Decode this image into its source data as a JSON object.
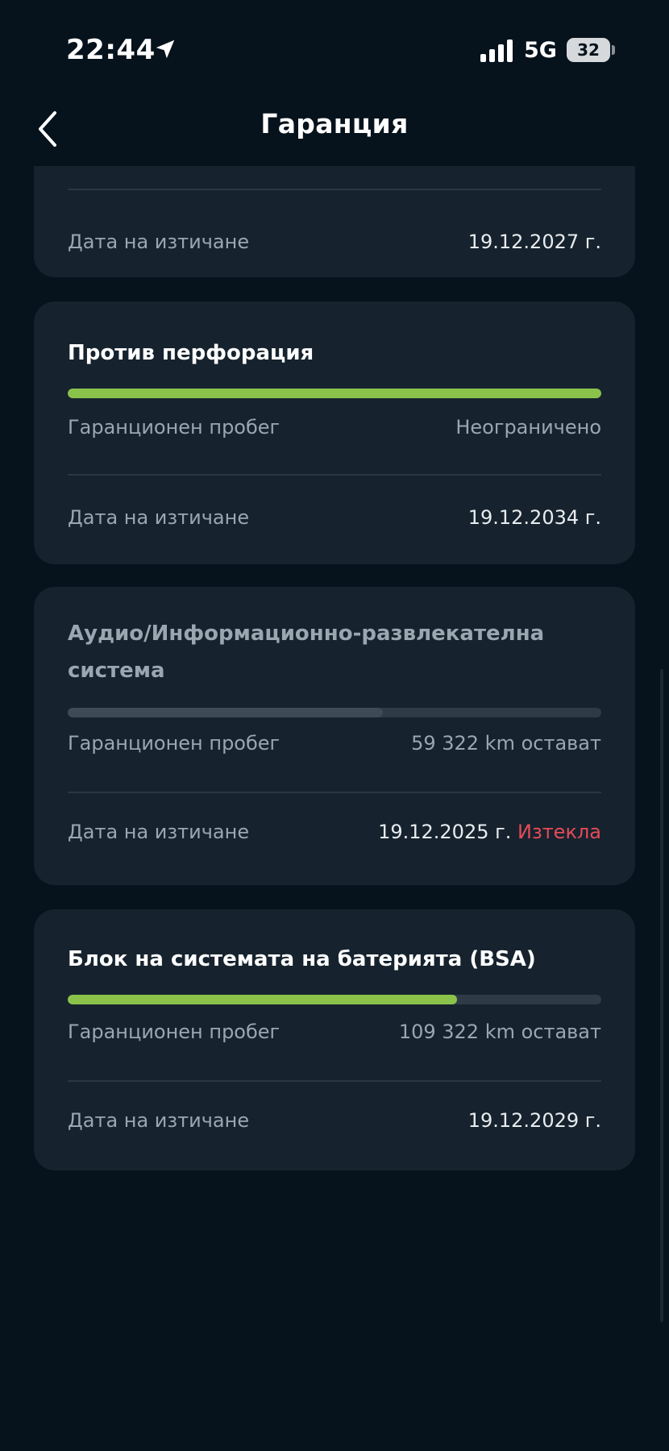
{
  "status_bar": {
    "time": "22:44",
    "network": "5G",
    "battery": "32"
  },
  "header": {
    "title": "Гаранция"
  },
  "colors": {
    "background": "#06121c",
    "card": "#16232e",
    "progress_fill": "#8bc34a",
    "progress_track": "#2e3b47",
    "expired": "#e64a58"
  },
  "cards": [
    {
      "title": "",
      "rows": [
        {
          "label": "Дата на изтичане",
          "value": "19.12.2027 г."
        }
      ]
    },
    {
      "title": "Против перфорация",
      "progress": 1.0,
      "rows": [
        {
          "label": "Гаранционен пробег",
          "value": "Неограничено"
        },
        {
          "label": "Дата на изтичане",
          "value": "19.12.2034 г."
        }
      ]
    },
    {
      "title": "Аудио/Информационно-развлекателна система",
      "title_line1": "Аудио/Информационно-развлекателна",
      "title_line2": "система",
      "progress": 0.59,
      "rows": [
        {
          "label": "Гаранционен пробег",
          "value": "59 322 km остават"
        },
        {
          "label": "Дата на изтичане",
          "value": "19.12.2025 г.",
          "status": "Изтекла"
        }
      ]
    },
    {
      "title": "Блок на системата на батерията (BSA)",
      "progress": 0.73,
      "rows": [
        {
          "label": "Гаранционен пробег",
          "value": "109 322 km остават"
        },
        {
          "label": "Дата на изтичане",
          "value": "19.12.2029 г."
        }
      ]
    }
  ]
}
